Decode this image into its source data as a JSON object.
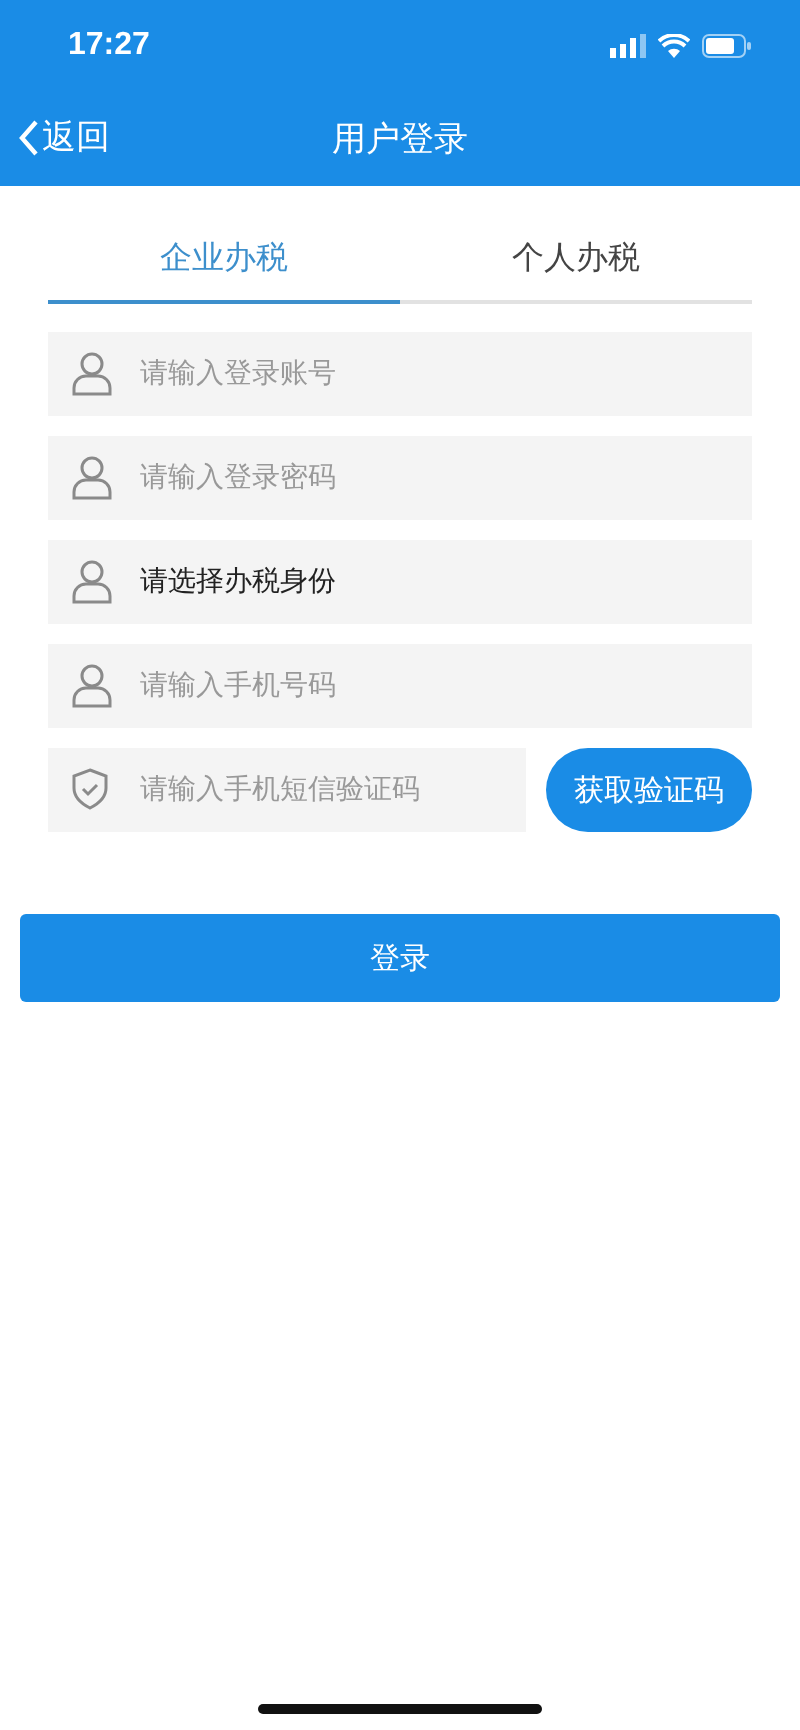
{
  "status_bar": {
    "time": "17:27"
  },
  "nav": {
    "back": "返回",
    "title": "用户登录"
  },
  "tabs": [
    {
      "label": "企业办税",
      "selected": true
    },
    {
      "label": "个人办税",
      "selected": false
    }
  ],
  "fields": [
    {
      "kind": "input",
      "placeholder": "请输入登录账号"
    },
    {
      "kind": "input",
      "placeholder": "请输入登录密码"
    },
    {
      "kind": "select",
      "value": "请选择办税身份"
    },
    {
      "kind": "input",
      "placeholder": "请输入手机号码"
    },
    {
      "kind": "code",
      "placeholder": "请输入手机短信验证码",
      "button": "获取验证码"
    }
  ],
  "login_button": "登录"
}
